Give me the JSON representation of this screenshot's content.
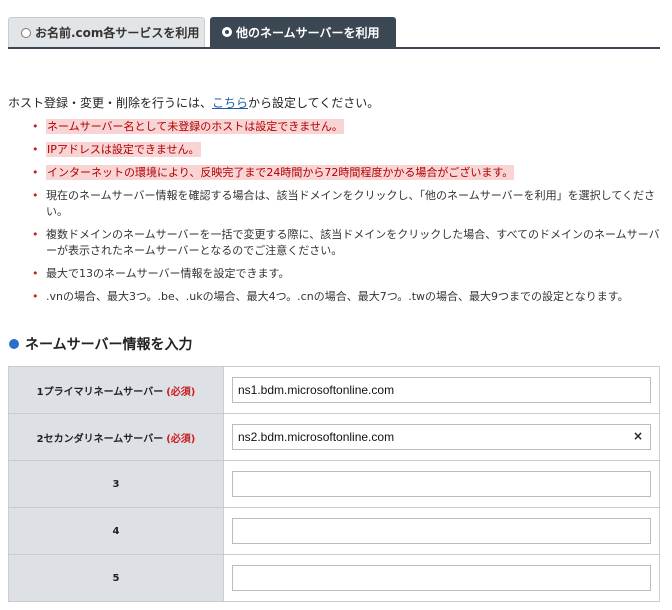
{
  "tabs": [
    {
      "label": "お名前.com各サービスを利用",
      "selected": false
    },
    {
      "label": "他のネームサーバーを利用",
      "selected": true
    }
  ],
  "intro": {
    "before": "ホスト登録・変更・削除を行うには、",
    "link": "こちら",
    "after": "から設定してください。"
  },
  "notes": [
    {
      "text": "ネームサーバー名として未登録のホストは設定できません。",
      "highlight": true
    },
    {
      "text": "IPアドレスは設定できません。",
      "highlight": true
    },
    {
      "text": "インターネットの環境により、反映完了まで24時間から72時間程度かかる場合がございます。",
      "highlight": true
    },
    {
      "text": "現在のネームサーバー情報を確認する場合は、該当ドメインをクリックし、「他のネームサーバーを利用」を選択してください。",
      "highlight": false
    },
    {
      "text": "複数ドメインのネームサーバーを一括で変更する際に、該当ドメインをクリックした場合、すべてのドメインのネームサーバーが表示されたネームサーバーとなるのでご注意ください。",
      "highlight": false
    },
    {
      "text": "最大で13のネームサーバー情報を設定できます。",
      "highlight": false
    },
    {
      "text": ".vnの場合、最大3つ。.be、.ukの場合、最大4つ。.cnの場合、最大7つ。.twの場合、最大9つまでの設定となります。",
      "highlight": false
    }
  ],
  "section": {
    "title": "ネームサーバー情報を入力"
  },
  "nameservers": [
    {
      "label": "1プライマリネームサーバー",
      "required": "(必須)",
      "value": "ns1.bdm.microsoftonline.com",
      "clear": ""
    },
    {
      "label": "2セカンダリネームサーバー",
      "required": "(必須)",
      "value": "ns2.bdm.microsoftonline.com",
      "clear": "×"
    },
    {
      "label": "3",
      "required": "",
      "value": "",
      "clear": ""
    },
    {
      "label": "4",
      "required": "",
      "value": "",
      "clear": ""
    },
    {
      "label": "5",
      "required": "",
      "value": "",
      "clear": ""
    }
  ],
  "colors": {
    "tab_active": "#3b4752",
    "accent_blue": "#2a6fc9",
    "warn_bg": "#f9d4d4",
    "warn_text": "#b00000"
  }
}
